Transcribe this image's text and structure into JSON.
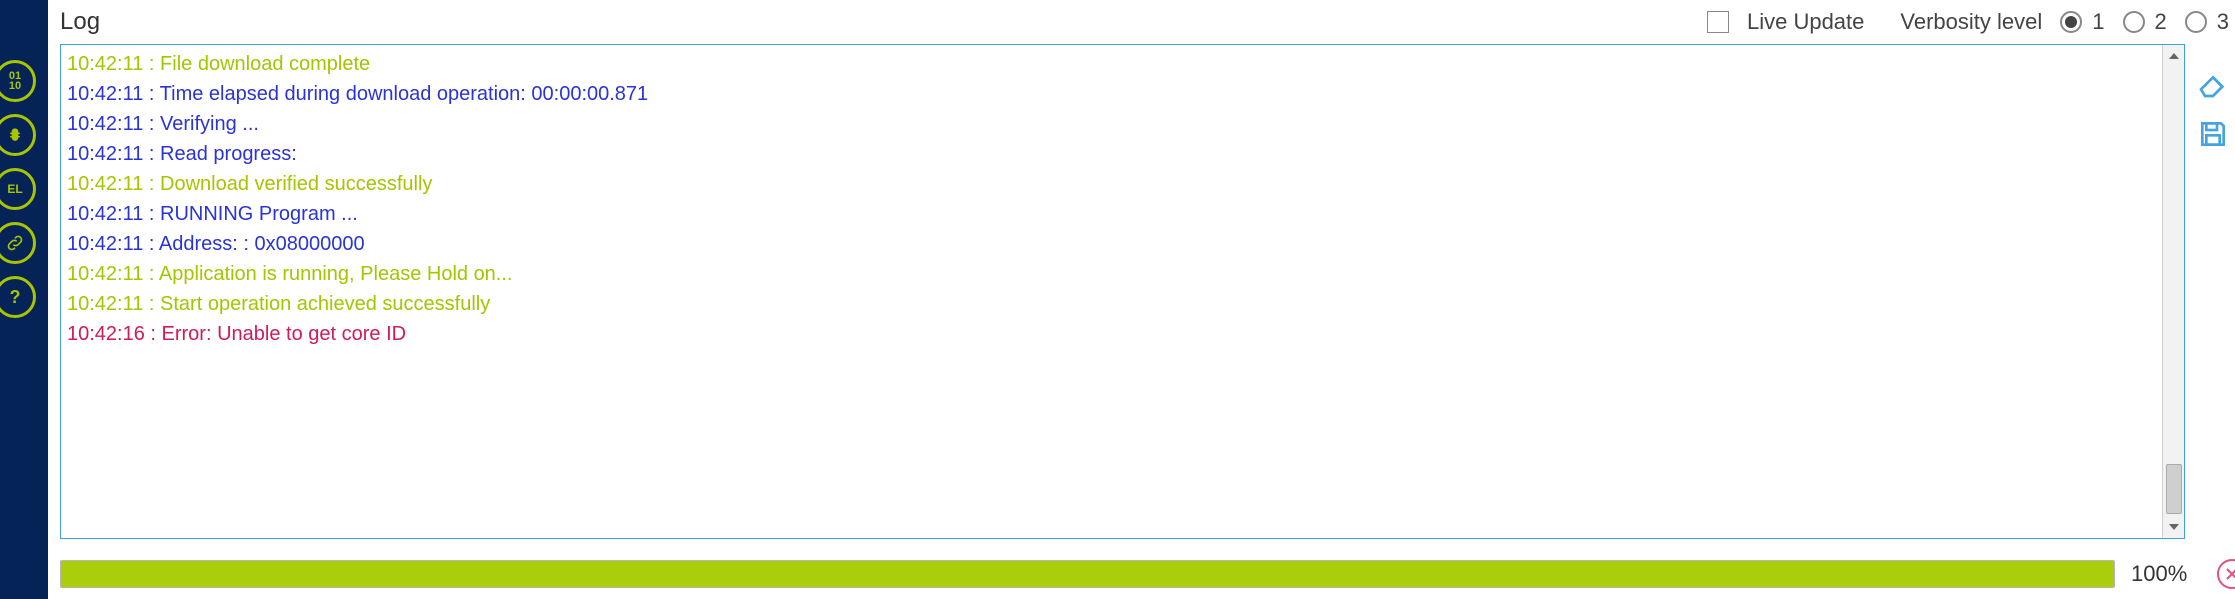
{
  "header": {
    "title": "Log",
    "live_update_label": "Live Update",
    "live_update_checked": false,
    "verbosity_label": "Verbosity level",
    "verbosity_options": [
      "1",
      "2",
      "3"
    ],
    "verbosity_selected": "1"
  },
  "sidebar": {
    "icons": [
      "binary-icon",
      "bug-icon",
      "el-icon",
      "link-icon",
      "help-icon"
    ]
  },
  "right_icons": [
    "erase-icon",
    "save-icon"
  ],
  "log": {
    "lines": [
      {
        "time": "10:42:11",
        "text": "File download complete",
        "level": "success"
      },
      {
        "time": "10:42:11",
        "text": "Time elapsed during download operation: 00:00:00.871",
        "level": "info"
      },
      {
        "time": "10:42:11",
        "text": "Verifying ...",
        "level": "info"
      },
      {
        "time": "10:42:11",
        "text": "Read progress:",
        "level": "info"
      },
      {
        "time": "10:42:11",
        "text": "Download verified successfully",
        "level": "success"
      },
      {
        "time": "10:42:11",
        "text": "RUNNING Program ...",
        "level": "info"
      },
      {
        "time": "10:42:11",
        "text": "  Address:      : 0x08000000",
        "level": "info"
      },
      {
        "time": "10:42:11",
        "text": "Application is running, Please Hold on...",
        "level": "success"
      },
      {
        "time": "10:42:11",
        "text": "Start operation achieved successfully",
        "level": "success"
      },
      {
        "time": "10:42:16",
        "text": "Error: Unable to get core ID",
        "level": "error"
      }
    ]
  },
  "progress": {
    "percent": 100,
    "label": "100%"
  }
}
